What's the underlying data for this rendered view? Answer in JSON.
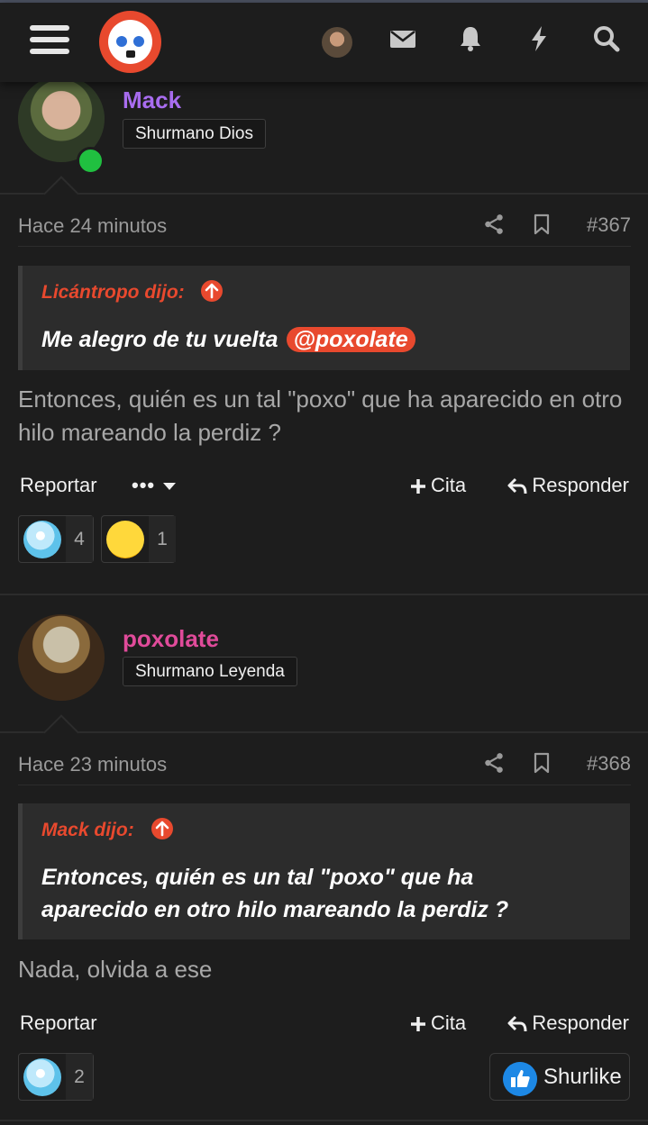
{
  "header": {
    "menu_icon": "hamburger-icon",
    "logo": "site-logo",
    "icons": [
      "user-avatar",
      "envelope-icon",
      "bell-icon",
      "bolt-icon",
      "search-icon"
    ]
  },
  "posts": [
    {
      "username": "Mack",
      "user_title": "Shurmano Dios",
      "online": true,
      "time": "Hace 24 minutos",
      "number": "#367",
      "quote": {
        "author": "Licántropo dijo:",
        "text": "Me alegro de tu vuelta",
        "mention": "@poxolate"
      },
      "body": "Entonces, quién es un tal \"poxo\" que ha aparecido en otro hilo mareando la perdiz ?",
      "actions": {
        "report": "Reportar",
        "more": "•••",
        "cite": "Cita",
        "reply": "Responder"
      },
      "reactions": [
        {
          "icon": "diamond-reaction-icon",
          "count": "4"
        },
        {
          "icon": "laughing-reaction-icon",
          "count": "1"
        }
      ]
    },
    {
      "username": "poxolate",
      "user_title": "Shurmano Leyenda",
      "online": false,
      "time": "Hace 23 minutos",
      "number": "#368",
      "quote": {
        "author": "Mack dijo:",
        "text": "Entonces, quién es un tal \"poxo\" que ha aparecido en otro hilo mareando la perdiz ?"
      },
      "body": "Nada, olvida a ese",
      "actions": {
        "report": "Reportar",
        "cite": "Cita",
        "reply": "Responder",
        "like": "Shurlike"
      },
      "reactions": [
        {
          "icon": "diamond-reaction-icon",
          "count": "2"
        }
      ]
    }
  ],
  "colors": {
    "background": "#1d1d1d",
    "accent": "#e8492e",
    "username_mack": "#a96df0",
    "username_poxolate": "#e04b9a",
    "online": "#20c040",
    "like_blue": "#1d88e5"
  }
}
